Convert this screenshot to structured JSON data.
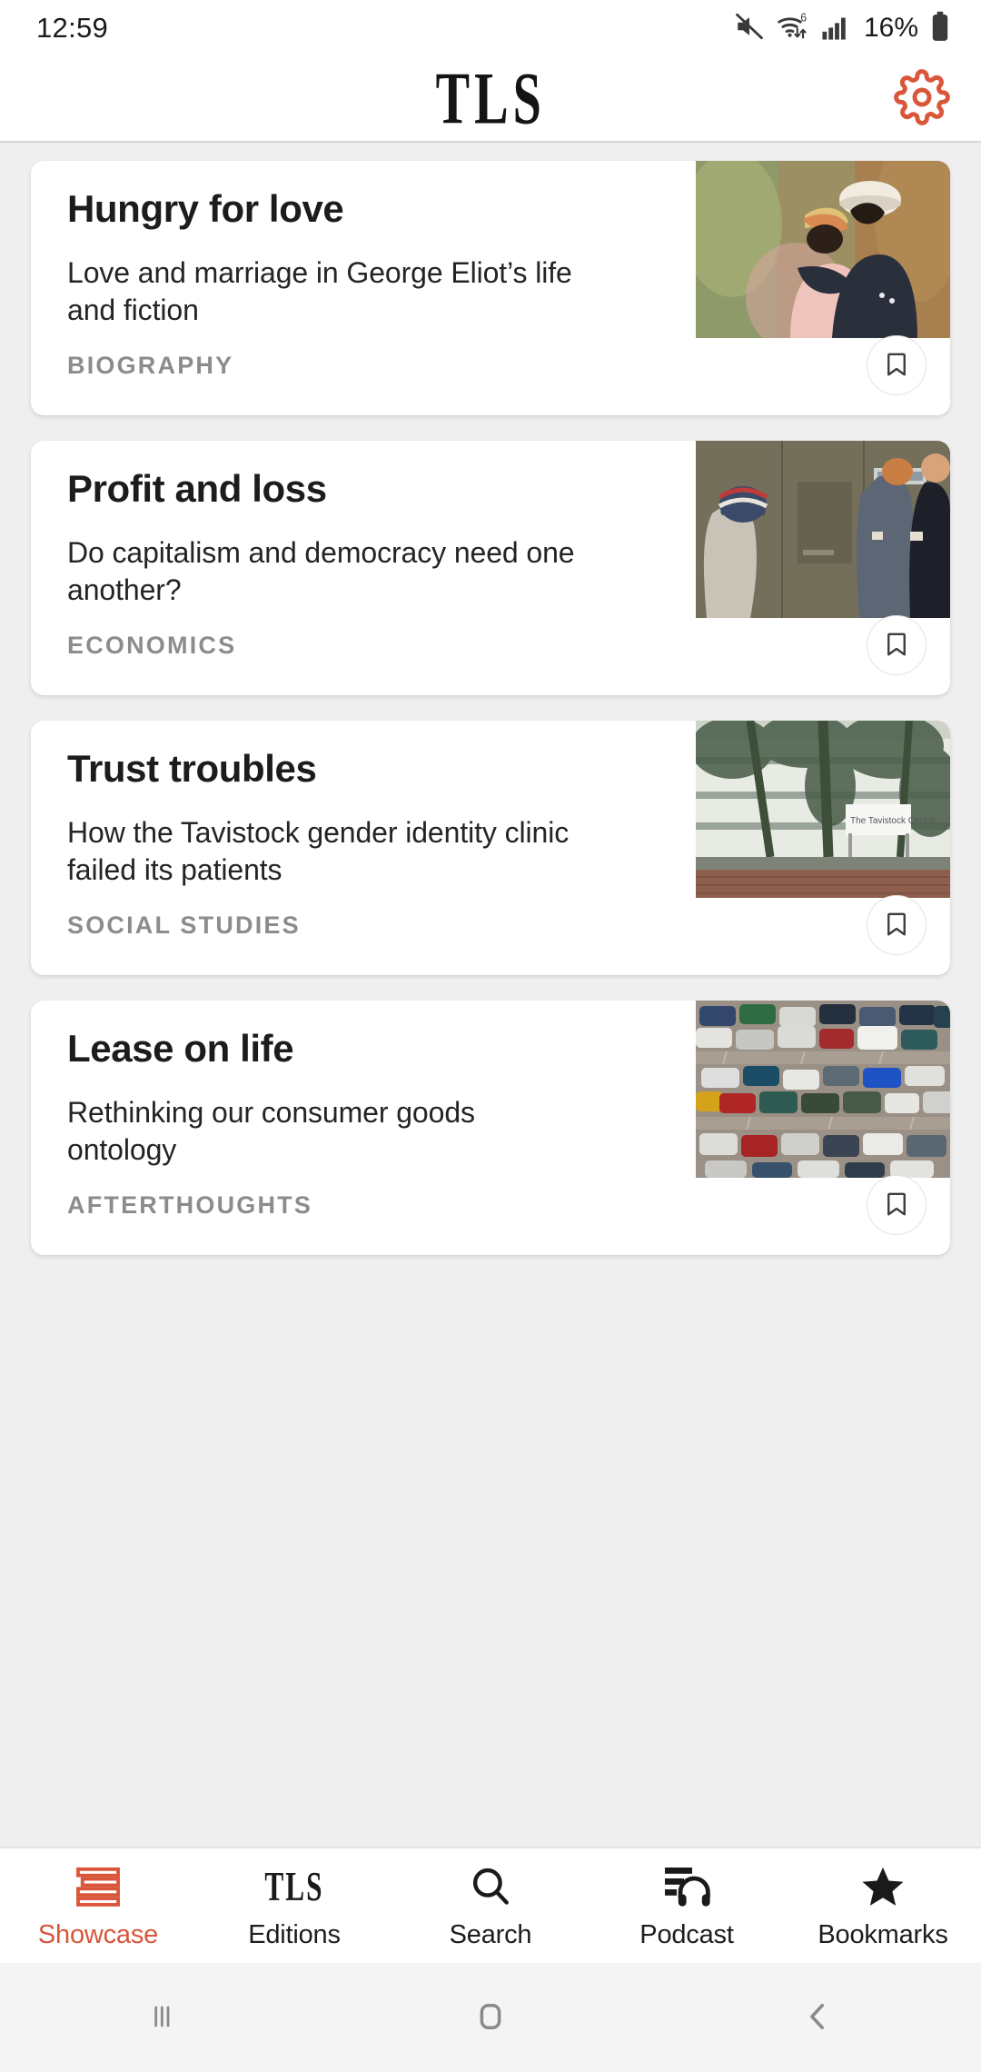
{
  "status_bar": {
    "time": "12:59",
    "battery_percent": "16%",
    "icons": [
      "mute-icon",
      "wifi-icon",
      "cellular-signal-icon",
      "battery-icon"
    ],
    "wifi_generation": "6"
  },
  "header": {
    "brand": "TLS",
    "settings_icon": "gear-icon",
    "accent_color": "#d9563a"
  },
  "feed": {
    "cards": [
      {
        "title": "Hungry for love",
        "subtitle": "Love and marriage in George Eliot’s life and fiction",
        "category": "BIOGRAPHY",
        "bookmark_icon": "bookmark-icon",
        "image_alt": "victorian-painting-couple-embracing"
      },
      {
        "title": "Profit and loss",
        "subtitle": "Do capitalism and democracy need one another?",
        "category": "ECONOMICS",
        "bookmark_icon": "bookmark-icon",
        "image_alt": "people-at-atm-machines"
      },
      {
        "title": "Trust troubles",
        "subtitle": "How the Tavistock gender identity clinic failed its patients",
        "category": "SOCIAL STUDIES",
        "bookmark_icon": "bookmark-icon",
        "image_alt": "tavistock-centre-building-with-trees"
      },
      {
        "title": "Lease on life",
        "subtitle": "Rethinking our consumer goods ontology",
        "category": "AFTERTHOUGHTS",
        "bookmark_icon": "bookmark-icon",
        "image_alt": "aerial-view-of-full-car-park"
      }
    ]
  },
  "bottom_nav": {
    "active": "Showcase",
    "items": [
      {
        "label": "Showcase",
        "icon": "stacked-bars-icon"
      },
      {
        "label": "Editions",
        "icon": "tls-logo-icon"
      },
      {
        "label": "Search",
        "icon": "search-icon"
      },
      {
        "label": "Podcast",
        "icon": "headphones-icon"
      },
      {
        "label": "Bookmarks",
        "icon": "star-icon"
      }
    ]
  },
  "android_nav": {
    "recents_label": "Recents",
    "home_label": "Home",
    "back_label": "Back"
  }
}
